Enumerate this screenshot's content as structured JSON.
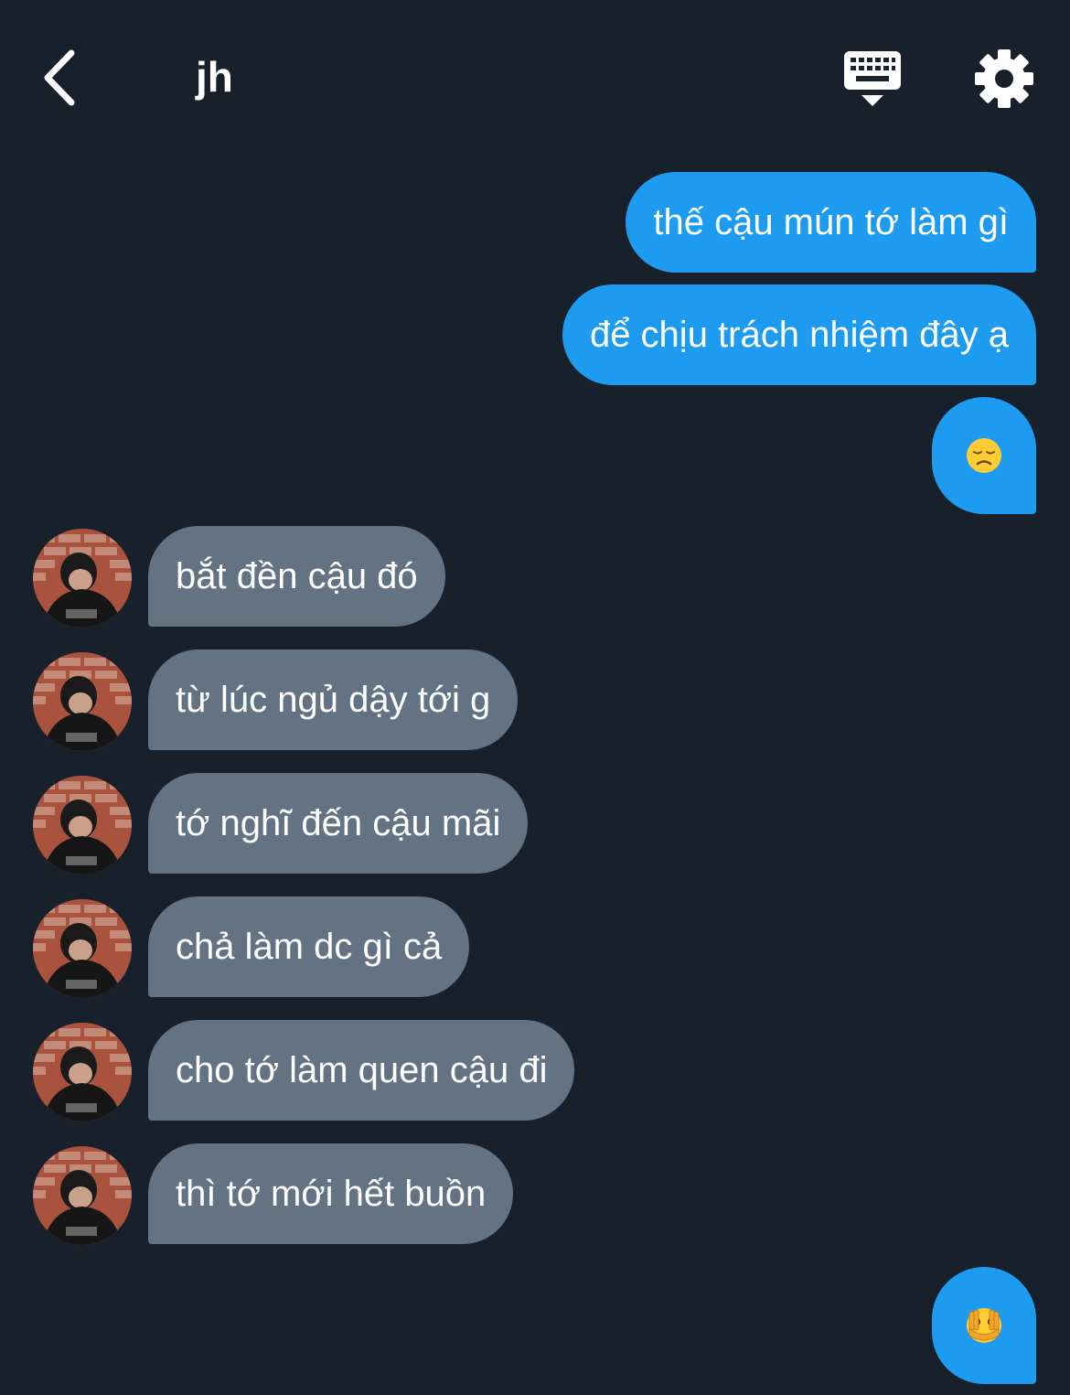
{
  "header": {
    "title": "jh",
    "back_icon": "chevron-left-icon",
    "keyboard_icon": "keyboard-icon",
    "settings_icon": "gear-icon"
  },
  "messages_out_top": [
    {
      "text": "thế cậu mún tớ làm gì"
    },
    {
      "text": "để chịu trách nhiệm đây ạ"
    }
  ],
  "emoji_1": {
    "icon": "disappointed-face-emoji"
  },
  "messages_in": [
    {
      "text": "bắt đền cậu đó"
    },
    {
      "text": "từ lúc ngủ dậy tới g"
    },
    {
      "text": "tớ nghĩ đến cậu mãi"
    },
    {
      "text": "chả làm dc gì cả"
    },
    {
      "text": "cho tớ làm quen cậu đi"
    },
    {
      "text": "thì tớ mới hết buồn"
    }
  ],
  "emoji_2": {
    "icon": "face-with-open-eyes-and-hand-over-mouth-emoji"
  },
  "colors": {
    "background": "#17202b",
    "outgoing_bubble": "#1d9bf0",
    "incoming_bubble": "#637384",
    "text": "#ffffff"
  }
}
